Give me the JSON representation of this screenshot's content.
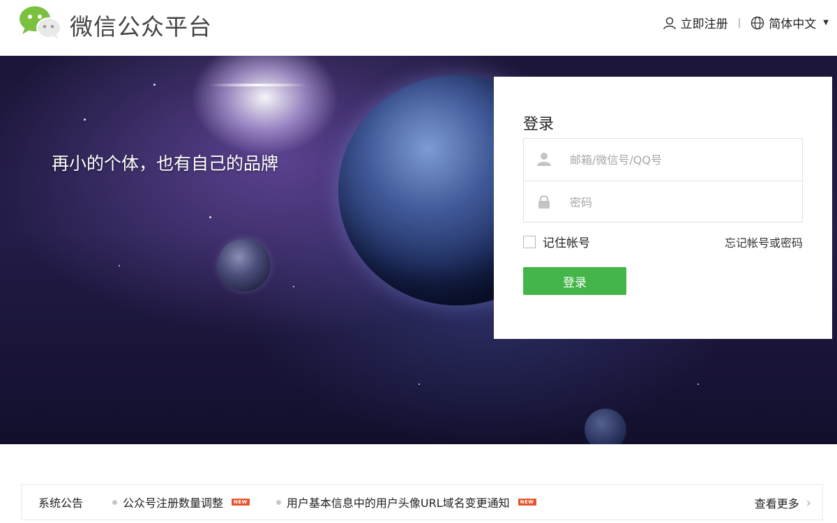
{
  "header": {
    "brand": "微信公众平台",
    "register_label": "立即注册",
    "separator": "|",
    "language_label": "简体中文",
    "icons": {
      "logo": "wechat-logo",
      "register": "user-icon",
      "language": "globe-icon",
      "dropdown": "caret-down-icon"
    }
  },
  "banner": {
    "slogan": "再小的个体，也有自己的品牌"
  },
  "login": {
    "title": "登录",
    "account_placeholder": "邮箱/微信号/QQ号",
    "account_value": "",
    "password_placeholder": "密码",
    "password_value": "",
    "remember_label": "记住帐号",
    "remember_checked": false,
    "forgot_label": "忘记帐号或密码",
    "submit_label": "登录",
    "accent_color": "#44b549"
  },
  "notice": {
    "title": "系统公告",
    "items": [
      {
        "text": "公众号注册数量调整",
        "badge": "NEW"
      },
      {
        "text": "用户基本信息中的用户头像URL域名变更通知",
        "badge": "NEW"
      }
    ],
    "more_label": "查看更多",
    "more_icon": "›"
  }
}
